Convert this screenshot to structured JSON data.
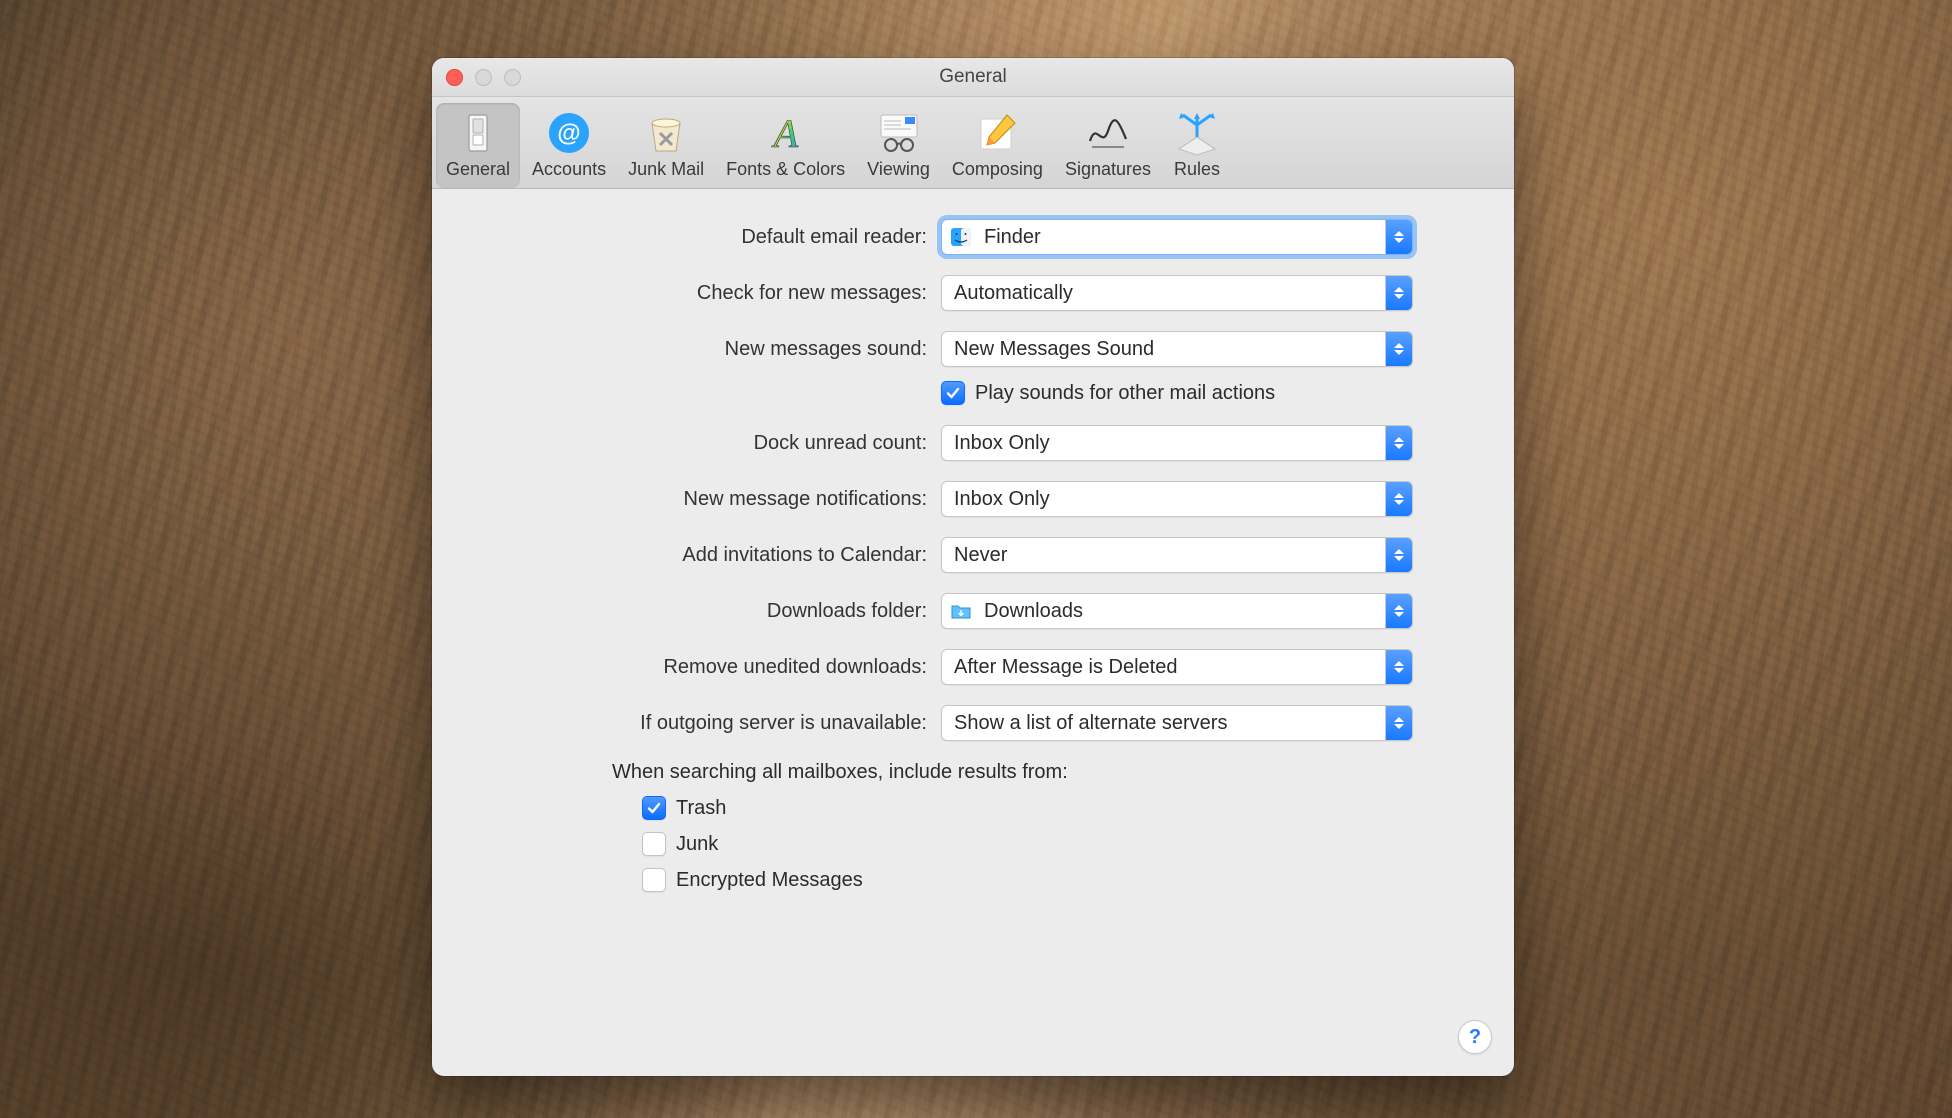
{
  "window": {
    "title": "General"
  },
  "toolbar": {
    "items": [
      {
        "id": "general",
        "label": "General",
        "selected": true
      },
      {
        "id": "accounts",
        "label": "Accounts",
        "selected": false
      },
      {
        "id": "junk",
        "label": "Junk Mail",
        "selected": false
      },
      {
        "id": "fonts",
        "label": "Fonts & Colors",
        "selected": false
      },
      {
        "id": "viewing",
        "label": "Viewing",
        "selected": false
      },
      {
        "id": "composing",
        "label": "Composing",
        "selected": false
      },
      {
        "id": "signatures",
        "label": "Signatures",
        "selected": false
      },
      {
        "id": "rules",
        "label": "Rules",
        "selected": false
      }
    ]
  },
  "settings": {
    "default_reader": {
      "label": "Default email reader:",
      "value": "Finder",
      "icon": "finder-icon"
    },
    "check_messages": {
      "label": "Check for new messages:",
      "value": "Automatically"
    },
    "new_sound": {
      "label": "New messages sound:",
      "value": "New Messages Sound"
    },
    "play_sounds": {
      "label": "Play sounds for other mail actions",
      "checked": true
    },
    "dock_unread": {
      "label": "Dock unread count:",
      "value": "Inbox Only"
    },
    "notifications": {
      "label": "New message notifications:",
      "value": "Inbox Only"
    },
    "add_invitations": {
      "label": "Add invitations to Calendar:",
      "value": "Never"
    },
    "downloads_folder": {
      "label": "Downloads folder:",
      "value": "Downloads",
      "icon": "downloads-folder-icon"
    },
    "remove_downloads": {
      "label": "Remove unedited downloads:",
      "value": "After Message is Deleted"
    },
    "outgoing_unavailable": {
      "label": "If outgoing server is unavailable:",
      "value": "Show a list of alternate servers"
    },
    "search_heading": "When searching all mailboxes, include results from:",
    "search_options": {
      "trash": {
        "label": "Trash",
        "checked": true
      },
      "junk": {
        "label": "Junk",
        "checked": false
      },
      "encrypted": {
        "label": "Encrypted Messages",
        "checked": false
      }
    }
  },
  "help_button": "?"
}
